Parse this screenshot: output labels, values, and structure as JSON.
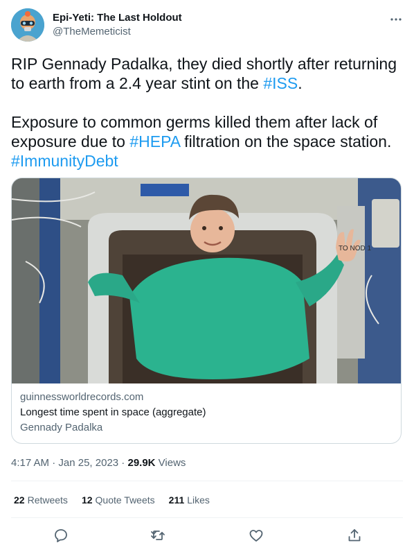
{
  "author": {
    "display_name": "Epi-Yeti: The Last Holdout",
    "handle": "@TheMemeticist"
  },
  "tweet": {
    "line1_prefix": "RIP Gennady Padalka, they died shortly after returning to earth from a 2.4 year stint on the ",
    "hashtag_iss": "#ISS",
    "line1_suffix": ".",
    "line2_prefix": "Exposure to common germs killed them after lack of exposure due to ",
    "hashtag_hepa": "#HEPA",
    "line2_middle": " filtration on the space station. ",
    "hashtag_immunity": "#ImmunityDebt"
  },
  "card": {
    "domain": "guinnessworldrecords.com",
    "title": "Longest time spent in space (aggregate)",
    "description": "Gennady Padalka",
    "image_label": "TO NOD 1"
  },
  "meta": {
    "time": "4:17 AM",
    "separator": " · ",
    "date": "Jan 25, 2023",
    "views_count": "29.9K",
    "views_label": " Views"
  },
  "stats": {
    "retweets_count": "22",
    "retweets_label": "Retweets",
    "quotes_count": "12",
    "quotes_label": "Quote Tweets",
    "likes_count": "211",
    "likes_label": "Likes"
  },
  "actions": [
    "reply-icon",
    "retweet-icon",
    "like-icon",
    "share-icon"
  ],
  "colors": {
    "link": "#1d9bf0",
    "secondary_text": "#536471",
    "primary_text": "#0f1419",
    "border": "#cfd9de"
  }
}
